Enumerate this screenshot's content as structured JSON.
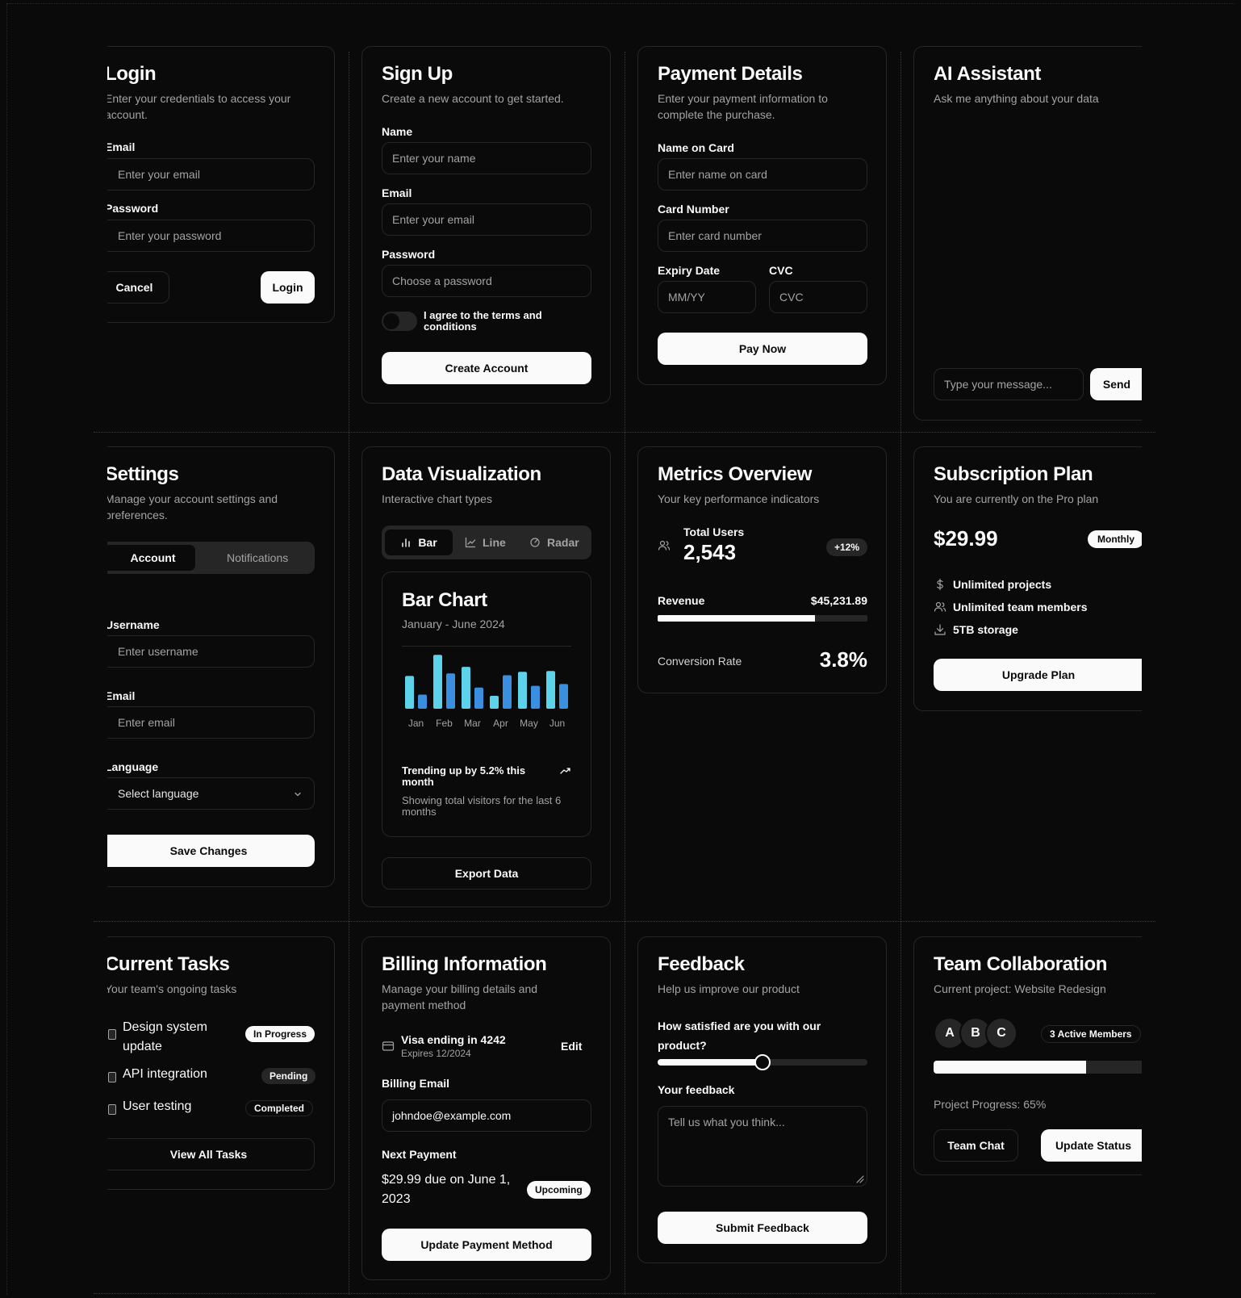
{
  "login": {
    "title": "Login",
    "subtitle": "Enter your credentials to access your account.",
    "email_label": "Email",
    "email_placeholder": "Enter your email",
    "password_label": "Password",
    "password_placeholder": "Enter your password",
    "cancel": "Cancel",
    "submit": "Login"
  },
  "signup": {
    "title": "Sign Up",
    "subtitle": "Create a new account to get started.",
    "name_label": "Name",
    "name_placeholder": "Enter your name",
    "email_label": "Email",
    "email_placeholder": "Enter your email",
    "password_label": "Password",
    "password_placeholder": "Choose a password",
    "terms": "I agree to the terms and conditions",
    "submit": "Create Account"
  },
  "payment": {
    "title": "Payment Details",
    "subtitle": "Enter your payment information to complete the purchase.",
    "name_label": "Name on Card",
    "name_placeholder": "Enter name on card",
    "number_label": "Card Number",
    "number_placeholder": "Enter card number",
    "expiry_label": "Expiry Date",
    "expiry_placeholder": "MM/YY",
    "cvc_label": "CVC",
    "cvc_placeholder": "CVC",
    "submit": "Pay Now"
  },
  "assistant": {
    "title": "AI Assistant",
    "subtitle": "Ask me anything about your data",
    "input_placeholder": "Type your message...",
    "send": "Send"
  },
  "settings": {
    "title": "Settings",
    "subtitle": "Manage your account settings and preferences.",
    "tabs": [
      "Account",
      "Notifications"
    ],
    "username_label": "Username",
    "username_placeholder": "Enter username",
    "email_label": "Email",
    "email_placeholder": "Enter email",
    "language_label": "Language",
    "language_value": "Select language",
    "submit": "Save Changes"
  },
  "dataviz": {
    "title": "Data Visualization",
    "subtitle": "Interactive chart types",
    "tabs": [
      "Bar",
      "Line",
      "Radar"
    ],
    "chart_title": "Bar Chart",
    "chart_subtitle": "January - June 2024",
    "trend": "Trending up by 5.2% this month",
    "trend_note": "Showing total visitors for the last 6 months",
    "export": "Export Data"
  },
  "chart_data": {
    "type": "bar",
    "categories": [
      "Jan",
      "Feb",
      "Mar",
      "Apr",
      "May",
      "Jun"
    ],
    "series": [
      {
        "color": "#5dd3eb",
        "values": [
          186,
          305,
          237,
          73,
          209,
          214
        ]
      },
      {
        "color": "#3b8fe0",
        "values": [
          80,
          200,
          120,
          190,
          130,
          140
        ]
      }
    ],
    "ylim": [
      0,
      320
    ],
    "grid": true
  },
  "metrics": {
    "title": "Metrics Overview",
    "subtitle": "Your key performance indicators",
    "users_label": "Total Users",
    "users_value": "2,543",
    "users_change": "+12%",
    "revenue_label": "Revenue",
    "revenue_value": "$45,231.89",
    "revenue_progress": 0.75,
    "conversion_label": "Conversion Rate",
    "conversion_value": "3.8%"
  },
  "subscription": {
    "title": "Subscription Plan",
    "subtitle": "You are currently on the Pro plan",
    "price": "$29.99",
    "period": "Monthly",
    "features": [
      "Unlimited projects",
      "Unlimited team members",
      "5TB storage"
    ],
    "submit": "Upgrade Plan"
  },
  "tasks": {
    "title": "Current Tasks",
    "subtitle": "Your team's ongoing tasks",
    "items": [
      {
        "name": "Design system update",
        "status": "In Progress"
      },
      {
        "name": "API integration",
        "status": "Pending"
      },
      {
        "name": "User testing",
        "status": "Completed"
      }
    ],
    "view_all": "View All Tasks"
  },
  "billing": {
    "title": "Billing Information",
    "subtitle": "Manage your billing details and payment method",
    "card": "Visa ending in 4242",
    "expires": "Expires 12/2024",
    "edit": "Edit",
    "email_label": "Billing Email",
    "email_value": "johndoe@example.com",
    "next_label": "Next Payment",
    "next_value": "$29.99 due on June 1, 2023",
    "next_status": "Upcoming",
    "submit": "Update Payment Method"
  },
  "feedback": {
    "title": "Feedback",
    "subtitle": "Help us improve our product",
    "question": "How satisfied are you with our product?",
    "slider_value": 0.5,
    "feedback_label": "Your feedback",
    "feedback_placeholder": "Tell us what you think...",
    "submit": "Submit Feedback"
  },
  "team": {
    "title": "Team Collaboration",
    "subtitle": "Current project: Website Redesign",
    "avatars": [
      "A",
      "B",
      "C"
    ],
    "active": "3 Active Members",
    "progress": 0.65,
    "progress_label": "Project Progress: 65%",
    "chat": "Team Chat",
    "update": "Update Status"
  }
}
